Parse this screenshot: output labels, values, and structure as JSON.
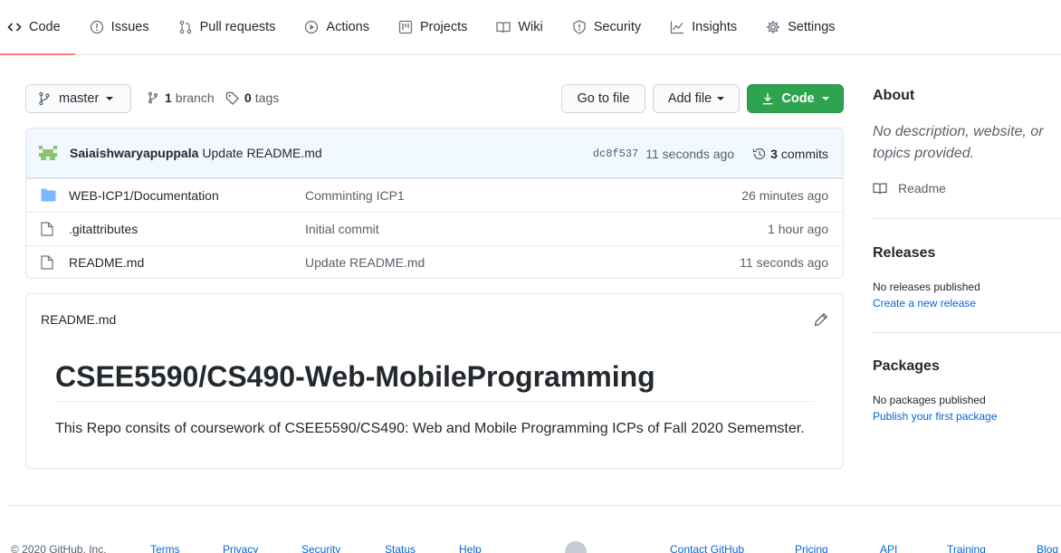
{
  "tabs": [
    {
      "label": "Code",
      "icon": "code-icon",
      "active": true
    },
    {
      "label": "Issues",
      "icon": "issue-icon"
    },
    {
      "label": "Pull requests",
      "icon": "pull-request-icon"
    },
    {
      "label": "Actions",
      "icon": "play-icon"
    },
    {
      "label": "Projects",
      "icon": "project-icon"
    },
    {
      "label": "Wiki",
      "icon": "book-icon"
    },
    {
      "label": "Security",
      "icon": "shield-icon"
    },
    {
      "label": "Insights",
      "icon": "graph-icon"
    },
    {
      "label": "Settings",
      "icon": "gear-icon"
    }
  ],
  "branchbar": {
    "branch": "master",
    "branches_count": "1",
    "branches_label": "branch",
    "tags_count": "0",
    "tags_label": "tags",
    "go_to_file": "Go to file",
    "add_file": "Add file",
    "code": "Code"
  },
  "commit": {
    "author": "Saiaishwaryapuppala",
    "message": "Update README.md",
    "sha": "dc8f537",
    "age": "11 seconds ago",
    "commits_count": "3",
    "commits_label": "commits"
  },
  "files": [
    {
      "type": "folder",
      "name_prefix": "WEB-ICP1/",
      "name": "Documentation",
      "commit": "Comminting ICP1",
      "age": "26 minutes ago"
    },
    {
      "type": "file",
      "name_prefix": "",
      "name": ".gitattributes",
      "commit": "Initial commit",
      "age": "1 hour ago"
    },
    {
      "type": "file",
      "name_prefix": "",
      "name": "README.md",
      "commit": "Update README.md",
      "age": "11 seconds ago"
    }
  ],
  "readme": {
    "header": "README.md",
    "title": "CSEE5590/CS490-Web-MobileProgramming",
    "body": "This Repo consits of coursework of CSEE5590/CS490: Web and Mobile Programming ICPs of Fall 2020 Sememster."
  },
  "sidebar": {
    "about_title": "About",
    "about_desc": "No description, website, or topics provided.",
    "readme_label": "Readme",
    "releases_title": "Releases",
    "releases_none": "No releases published",
    "releases_link": "Create a new release",
    "packages_title": "Packages",
    "packages_none": "No packages published",
    "packages_link": "Publish your first package"
  },
  "footer": {
    "copyright": "© 2020 GitHub, Inc.",
    "links_left": [
      "Terms",
      "Privacy",
      "Security",
      "Status",
      "Help"
    ],
    "links_right": [
      "Contact GitHub",
      "Pricing",
      "API",
      "Training",
      "Blog"
    ]
  },
  "colors": {
    "accent_tab": "#f9826c",
    "green_button": "#2ea44f",
    "link": "#0366d6",
    "folder": "#79b8ff"
  }
}
